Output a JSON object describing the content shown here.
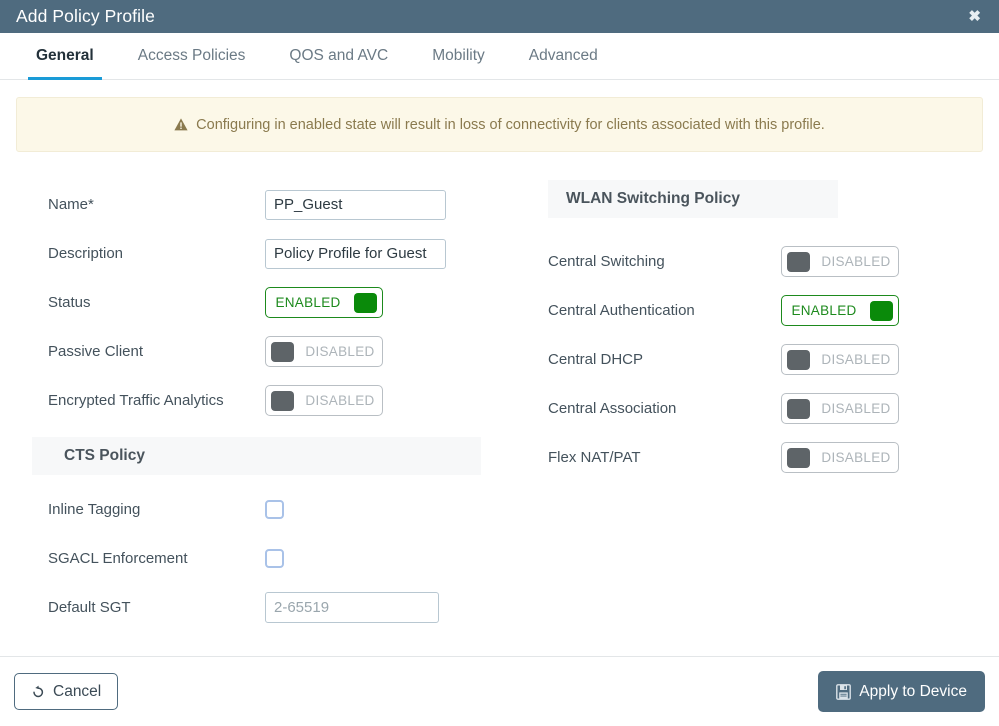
{
  "window": {
    "title": "Add Policy Profile",
    "close_icon": "close-icon",
    "close_glyph": "✖"
  },
  "colors": {
    "header_bg": "#4f6b7f",
    "active_tab_underline": "#1a9bd7",
    "warning_bg": "#fcf8e8",
    "warning_text": "#8a7a4e",
    "toggle_on": "#0a8a0a",
    "toggle_off": "#5e6468",
    "section_bg": "#f7f8f9",
    "apply_button_bg": "#4f6b7f"
  },
  "tabs": [
    {
      "label": "General",
      "active": true
    },
    {
      "label": "Access Policies",
      "active": false
    },
    {
      "label": "QOS and AVC",
      "active": false
    },
    {
      "label": "Mobility",
      "active": false
    },
    {
      "label": "Advanced",
      "active": false
    }
  ],
  "warning": {
    "icon": "warning-triangle-icon",
    "message": "Configuring in enabled state will result in loss of connectivity for clients associated with this profile."
  },
  "left_column": {
    "fields": [
      {
        "label": "Name*",
        "type": "text",
        "value": "PP_Guest",
        "placeholder": ""
      },
      {
        "label": "Description",
        "type": "text",
        "value": "Policy Profile for Guest",
        "placeholder": ""
      },
      {
        "label": "Status",
        "type": "toggle",
        "state": "ENABLED",
        "on": true
      },
      {
        "label": "Passive Client",
        "type": "toggle",
        "state": "DISABLED",
        "on": false
      },
      {
        "label": "Encrypted Traffic Analytics",
        "type": "toggle",
        "state": "DISABLED",
        "on": false
      }
    ],
    "cts_section": {
      "title": "CTS Policy",
      "fields": [
        {
          "label": "Inline Tagging",
          "type": "checkbox",
          "checked": false
        },
        {
          "label": "SGACL Enforcement",
          "type": "checkbox",
          "checked": false
        },
        {
          "label": "Default SGT",
          "type": "text",
          "value": "",
          "placeholder": "2-65519"
        }
      ]
    }
  },
  "right_column": {
    "section": {
      "title": "WLAN Switching Policy",
      "fields": [
        {
          "label": "Central Switching",
          "type": "toggle",
          "state": "DISABLED",
          "on": false
        },
        {
          "label": "Central Authentication",
          "type": "toggle",
          "state": "ENABLED",
          "on": true
        },
        {
          "label": "Central DHCP",
          "type": "toggle",
          "state": "DISABLED",
          "on": false
        },
        {
          "label": "Central Association",
          "type": "toggle",
          "state": "DISABLED",
          "on": false
        },
        {
          "label": "Flex NAT/PAT",
          "type": "toggle",
          "state": "DISABLED",
          "on": false
        }
      ]
    }
  },
  "footer": {
    "cancel_label": "Cancel",
    "cancel_icon": "undo-icon",
    "apply_label": "Apply to Device",
    "apply_icon": "save-floppy-icon"
  }
}
